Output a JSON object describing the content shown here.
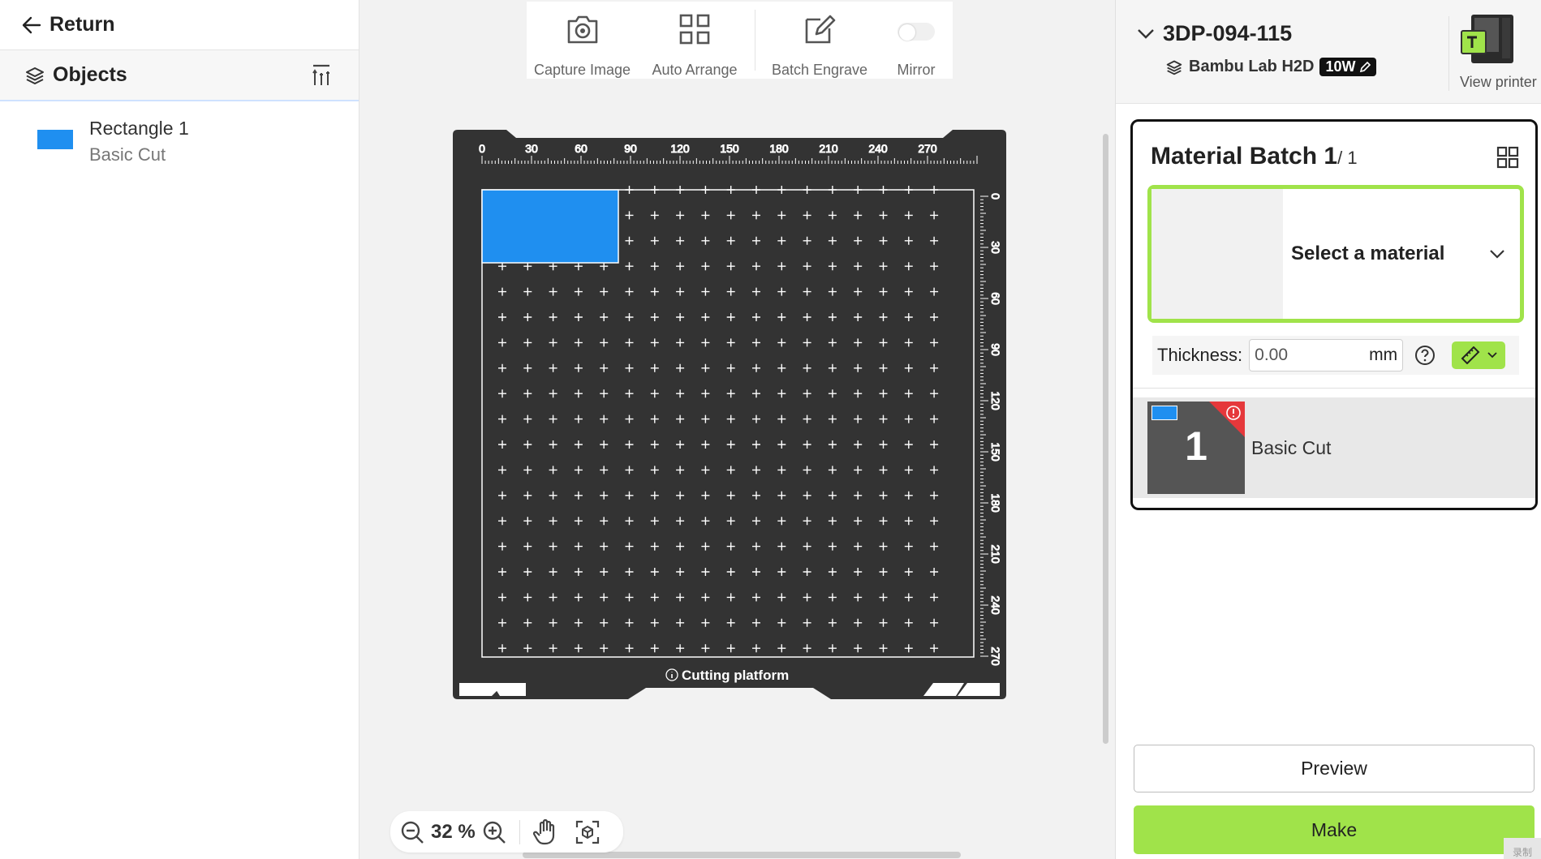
{
  "nav": {
    "return_label": "Return"
  },
  "objects_panel": {
    "title": "Objects",
    "items": [
      {
        "name": "Rectangle 1",
        "sub": "Basic Cut",
        "color": "#1f8ff0"
      }
    ]
  },
  "toolbar": {
    "capture_label": "Capture Image",
    "arrange_label": "Auto Arrange",
    "batch_label": "Batch Engrave",
    "mirror_label": "Mirror",
    "mirror_on": false
  },
  "canvas": {
    "ruler_top": [
      "0",
      "30",
      "60",
      "90",
      "120",
      "150",
      "180",
      "210",
      "240",
      "270"
    ],
    "ruler_side": [
      "0",
      "30",
      "60",
      "90",
      "120",
      "150",
      "180",
      "210",
      "240",
      "270"
    ],
    "platform_label": "Cutting platform",
    "bed_color": "#333333",
    "object_color": "#1f8ff0"
  },
  "zoom": {
    "value": "32 %"
  },
  "printer": {
    "name": "3DP-094-115",
    "model": "Bambu Lab H2D",
    "power": "10W",
    "view_label": "View printer"
  },
  "batch": {
    "title": "Material Batch 1",
    "count": "/ 1",
    "material_placeholder": "Select a material",
    "thickness_label": "Thickness:",
    "thickness_value": "0.00",
    "thickness_unit": "mm",
    "plate_number": "1",
    "plate_label": "Basic Cut"
  },
  "actions": {
    "preview_label": "Preview",
    "make_label": "Make"
  },
  "colors": {
    "accent": "#a0e34a",
    "warning": "#e5383b",
    "selection": "#1f8ff0"
  },
  "watermark": "录制"
}
